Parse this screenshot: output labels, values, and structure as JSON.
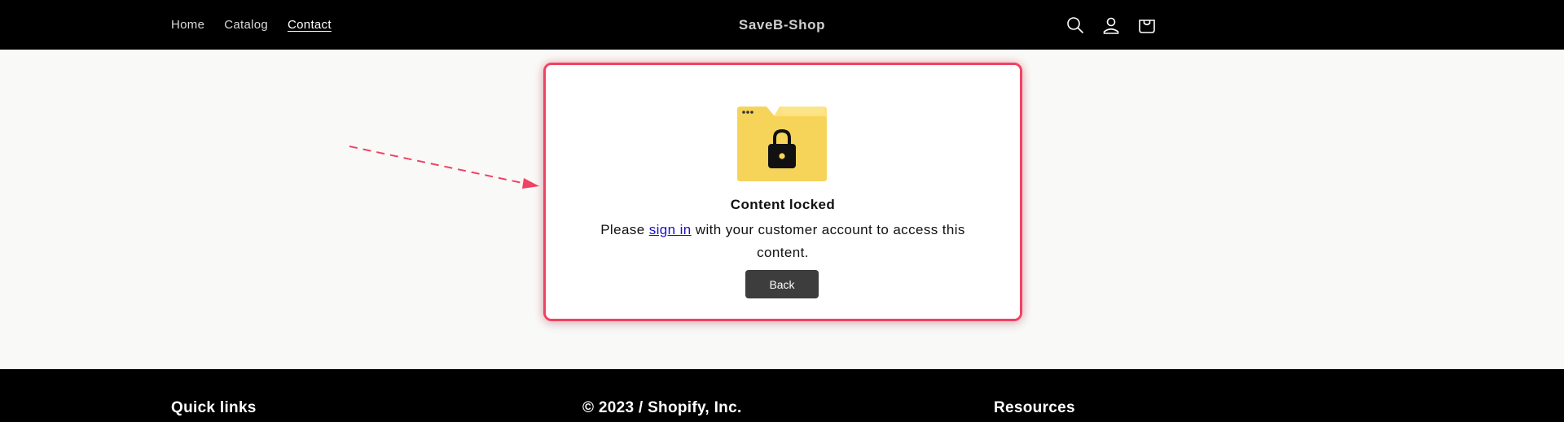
{
  "header": {
    "nav": [
      "Home",
      "Catalog",
      "Contact"
    ],
    "brand": "SaveB-Shop",
    "icons": [
      "search-icon",
      "account-icon",
      "cart-icon"
    ]
  },
  "modal": {
    "icon": "locked-folder-icon",
    "title": "Content locked",
    "message_before": "Please ",
    "sign_in_link": "sign in",
    "message_after": " with your customer account to access this content.",
    "back_button": "Back"
  },
  "annotation": {
    "arrow_color": "#f04262"
  },
  "footer": {
    "quick_links": "Quick links",
    "copyright": "© 2023 / Shopify, Inc.",
    "resources": "Resources"
  },
  "colors": {
    "accent_outline": "#f04262",
    "link": "#1a0dcc",
    "button_bg": "#3d3d3d",
    "folder_yellow": "#f6d45a"
  }
}
